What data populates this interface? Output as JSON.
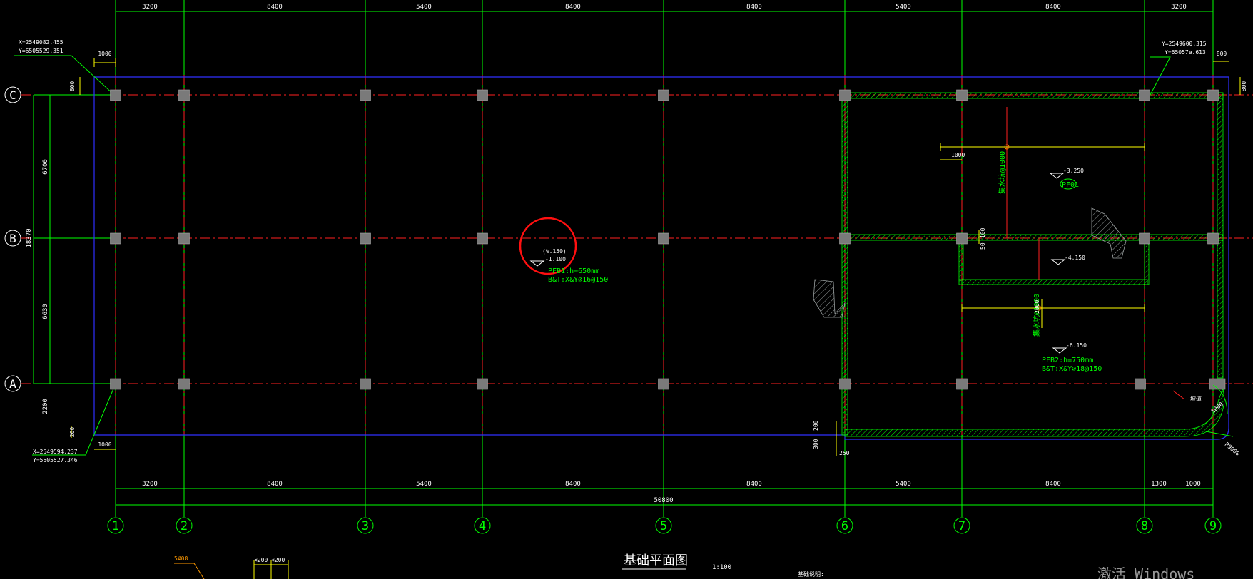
{
  "drawing": {
    "title": "基础平面图",
    "scale": "1:100",
    "notes_heading": "基础说明:",
    "watermark": "激活 Windows"
  },
  "dims": {
    "top": [
      "3200",
      "8400",
      "5400",
      "8400",
      "8400",
      "5400",
      "8400",
      "3200"
    ],
    "bottom": [
      "3200",
      "8400",
      "5400",
      "8400",
      "8400",
      "5400",
      "8400",
      "1300",
      "1000"
    ],
    "total": "50800",
    "left": [
      "6700",
      "6630",
      "2200"
    ],
    "left_total": "18370",
    "offset_1000_tl": "1000",
    "offset_800_tl": "800",
    "offset_1000_bl": "1000",
    "offset_200_bl": "200",
    "offset_800_tr": "800",
    "offset_800_tr2": "800",
    "pit_1000": "1000",
    "pit_2000": "2000",
    "pit_100": "100",
    "pit_50": "50",
    "pit_200": "200",
    "pit_300": "300",
    "pit_250": "250",
    "ramp_1000": "1000"
  },
  "axes": {
    "columns": [
      "1",
      "2",
      "3",
      "4",
      "5",
      "6",
      "7",
      "8",
      "9"
    ],
    "rows": [
      "C",
      "B",
      "A"
    ]
  },
  "coords": {
    "tl_x": "X=2549082.455",
    "tl_y": "Y=6505529.351",
    "bl_x": "X=2549594.237",
    "bl_y": "Y=5505527.346",
    "tr_x": "Y=2549600.315",
    "tr_y": "Y=65057e.613"
  },
  "annotations": {
    "circled_elev": "(%.150)",
    "circled_elev2": "-1.100",
    "raft1": "PFB1:h=650mm",
    "raft1_reinf": "B&T:X&Y⌀16@150",
    "elev_325": "-3.250",
    "pit_tag": "PF01",
    "elev_415": "-4.150",
    "elev_615": "-6.150",
    "raft2": "PFB2:h=750mm",
    "raft2_reinf": "B&T:X&Y⌀18@150",
    "vert_note1": "集水坑@1000",
    "vert_note2": "集水坑@1000",
    "ramp": "R9000",
    "ramp2": "坡道",
    "bottom_left_a": "5#08",
    "bottom_left_b": "<200",
    "bottom_left_c": "<200"
  },
  "colors": {
    "grid_axis": "#ff2020",
    "grid_line": "#00ff00",
    "outline": "#2020ff",
    "column": "#7a7a7a",
    "dim": "#ffff00",
    "wall_hatch": "#00ff00",
    "text": "#ffffff",
    "circle": "#ff0000"
  }
}
